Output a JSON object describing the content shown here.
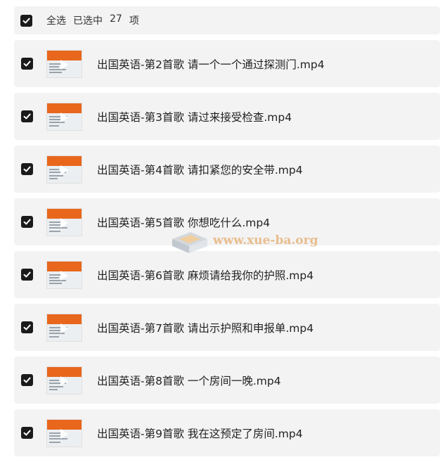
{
  "header": {
    "select_all_label": "全选",
    "selected_prefix": "已选中",
    "selected_count": "27",
    "selected_suffix": "项"
  },
  "files": [
    {
      "name": "出国英语-第2首歌 请一个一个通过探测门.mp4"
    },
    {
      "name": "出国英语-第3首歌 请过来接受检查.mp4"
    },
    {
      "name": "出国英语-第4首歌 请扣紧您的安全带.mp4"
    },
    {
      "name": "出国英语-第5首歌 你想吃什么.mp4"
    },
    {
      "name": "出国英语-第6首歌 麻烦请给我你的护照.mp4"
    },
    {
      "name": "出国英语-第7首歌 请出示护照和申报单.mp4"
    },
    {
      "name": "出国英语-第8首歌 一个房间一晚.mp4"
    },
    {
      "name": "出国英语-第9首歌 我在这预定了房间.mp4"
    }
  ],
  "watermark": {
    "text": "www.xue-ba.org"
  },
  "colors": {
    "checkbox": "#1b1b1b",
    "row_bg": "#f3f3f4",
    "thumb_accent": "#e8671c",
    "watermark": "#e7b47a"
  },
  "icons": {
    "checkbox": "checkbox-checked-icon",
    "thumbnail": "video-thumbnail",
    "play": "play-icon"
  }
}
